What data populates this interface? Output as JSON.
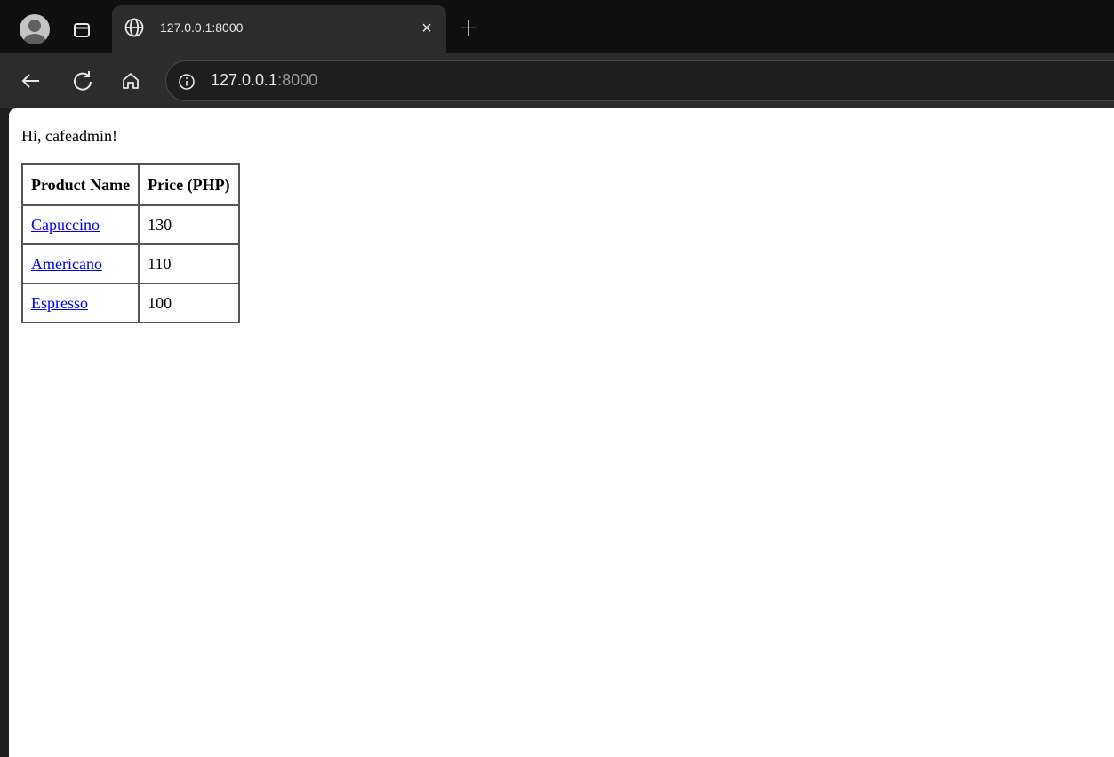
{
  "tab": {
    "title": "127.0.0.1:8000",
    "close_glyph": "×",
    "favicon": "globe-icon"
  },
  "new_tab_glyph": "+",
  "toolbar": {
    "url_host": "127.0.0.1",
    "url_port": ":8000"
  },
  "page": {
    "greeting": "Hi, cafeadmin!",
    "table": {
      "headers": [
        "Product Name",
        "Price (PHP)"
      ],
      "rows": [
        {
          "name": "Capuccino",
          "price": "130"
        },
        {
          "name": "Americano",
          "price": "110"
        },
        {
          "name": "Espresso",
          "price": "100"
        }
      ]
    }
  },
  "colors": {
    "tabstrip": "#0f0f0f",
    "toolbar": "#2c2c2c",
    "link": "#0000ee"
  }
}
